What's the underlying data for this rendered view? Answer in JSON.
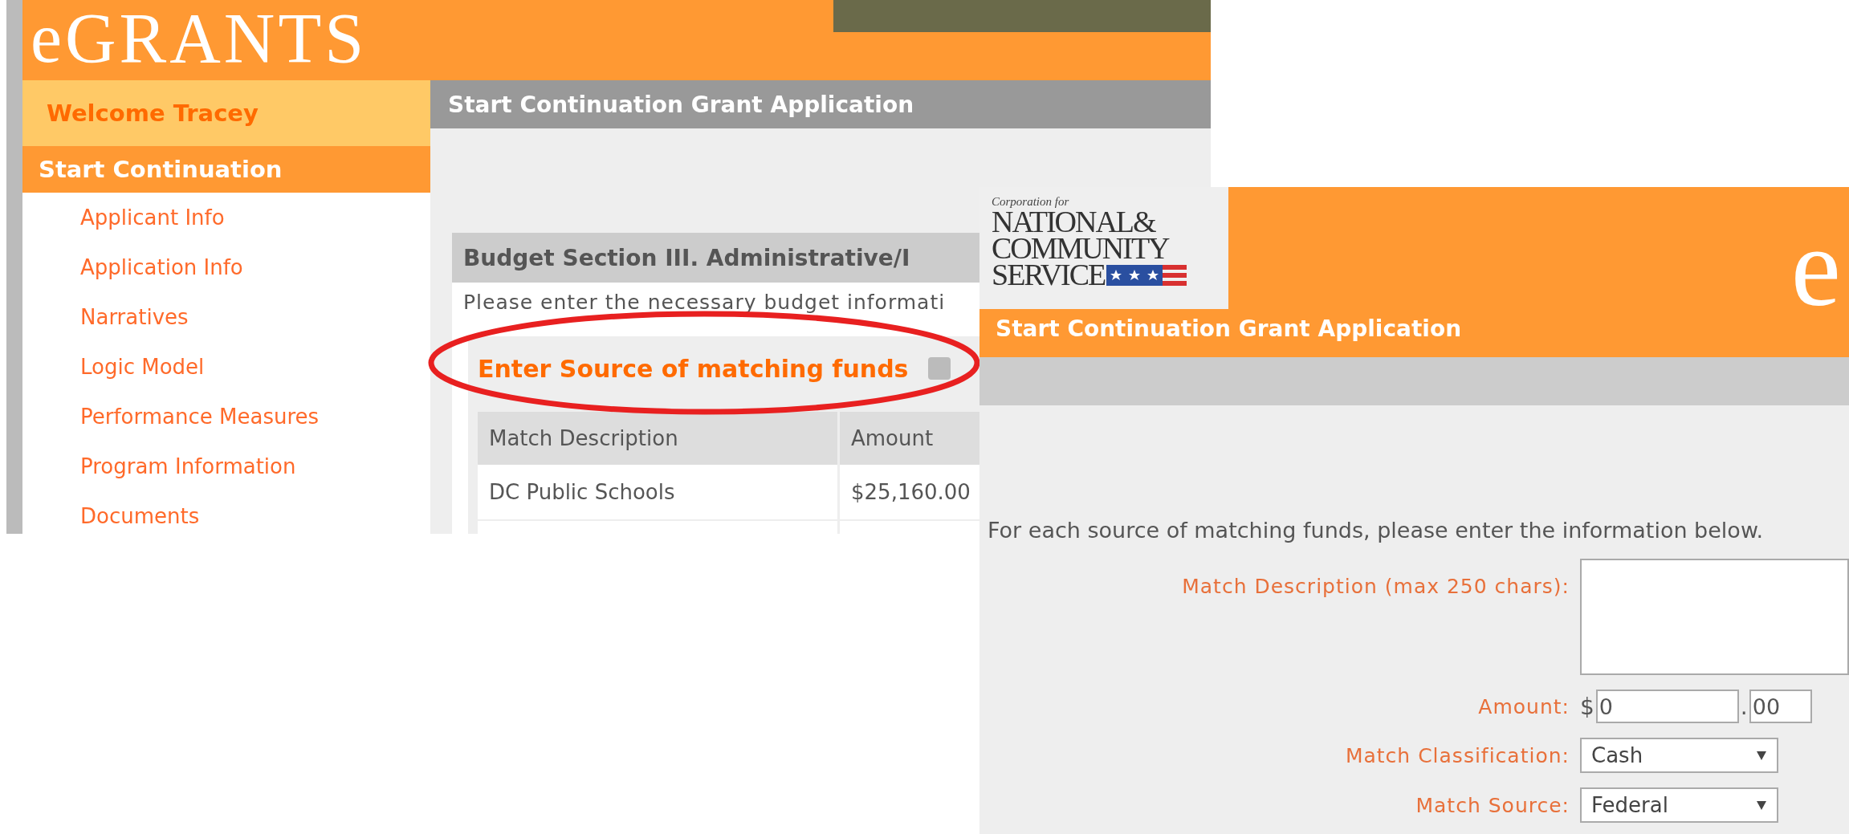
{
  "left_screen": {
    "logo": "eGRANTS",
    "sidebar": {
      "welcome": "Welcome Tracey",
      "section": "Start Continuation",
      "items": [
        "Applicant Info",
        "Application Info",
        "Narratives",
        "Logic Model",
        "Performance Measures",
        "Program Information",
        "Documents"
      ]
    },
    "page_title": "Start Continuation Grant Application",
    "budget_section": {
      "title": "Budget Section III. Administrative/I",
      "instructions": "Please enter the necessary budget informati",
      "subsection_title": "Enter Source of matching funds",
      "table": {
        "columns": [
          "Match Description",
          "Amount"
        ],
        "rows": [
          [
            "DC Public Schools",
            "$25,160.00"
          ]
        ]
      }
    }
  },
  "right_screen": {
    "org_logo": {
      "tagline": "Corporation for",
      "lines": [
        "NATIONAL&",
        "COMMUNITY",
        "SERVICE"
      ]
    },
    "brand": "e",
    "page_title": "Start Continuation Grant Application",
    "instructions": "For each source of matching funds, please enter the information below.",
    "fields": [
      {
        "kind": "textarea",
        "label": "Match Description (max 250 chars):"
      },
      {
        "kind": "amount",
        "label": "Amount:",
        "prefix": "$",
        "dollars": "0",
        "separator": ".",
        "cents": "00"
      },
      {
        "kind": "select",
        "label": "Match Classification:",
        "value": "Cash"
      },
      {
        "kind": "select",
        "label": "Match Source:",
        "value": "Federal"
      }
    ]
  }
}
